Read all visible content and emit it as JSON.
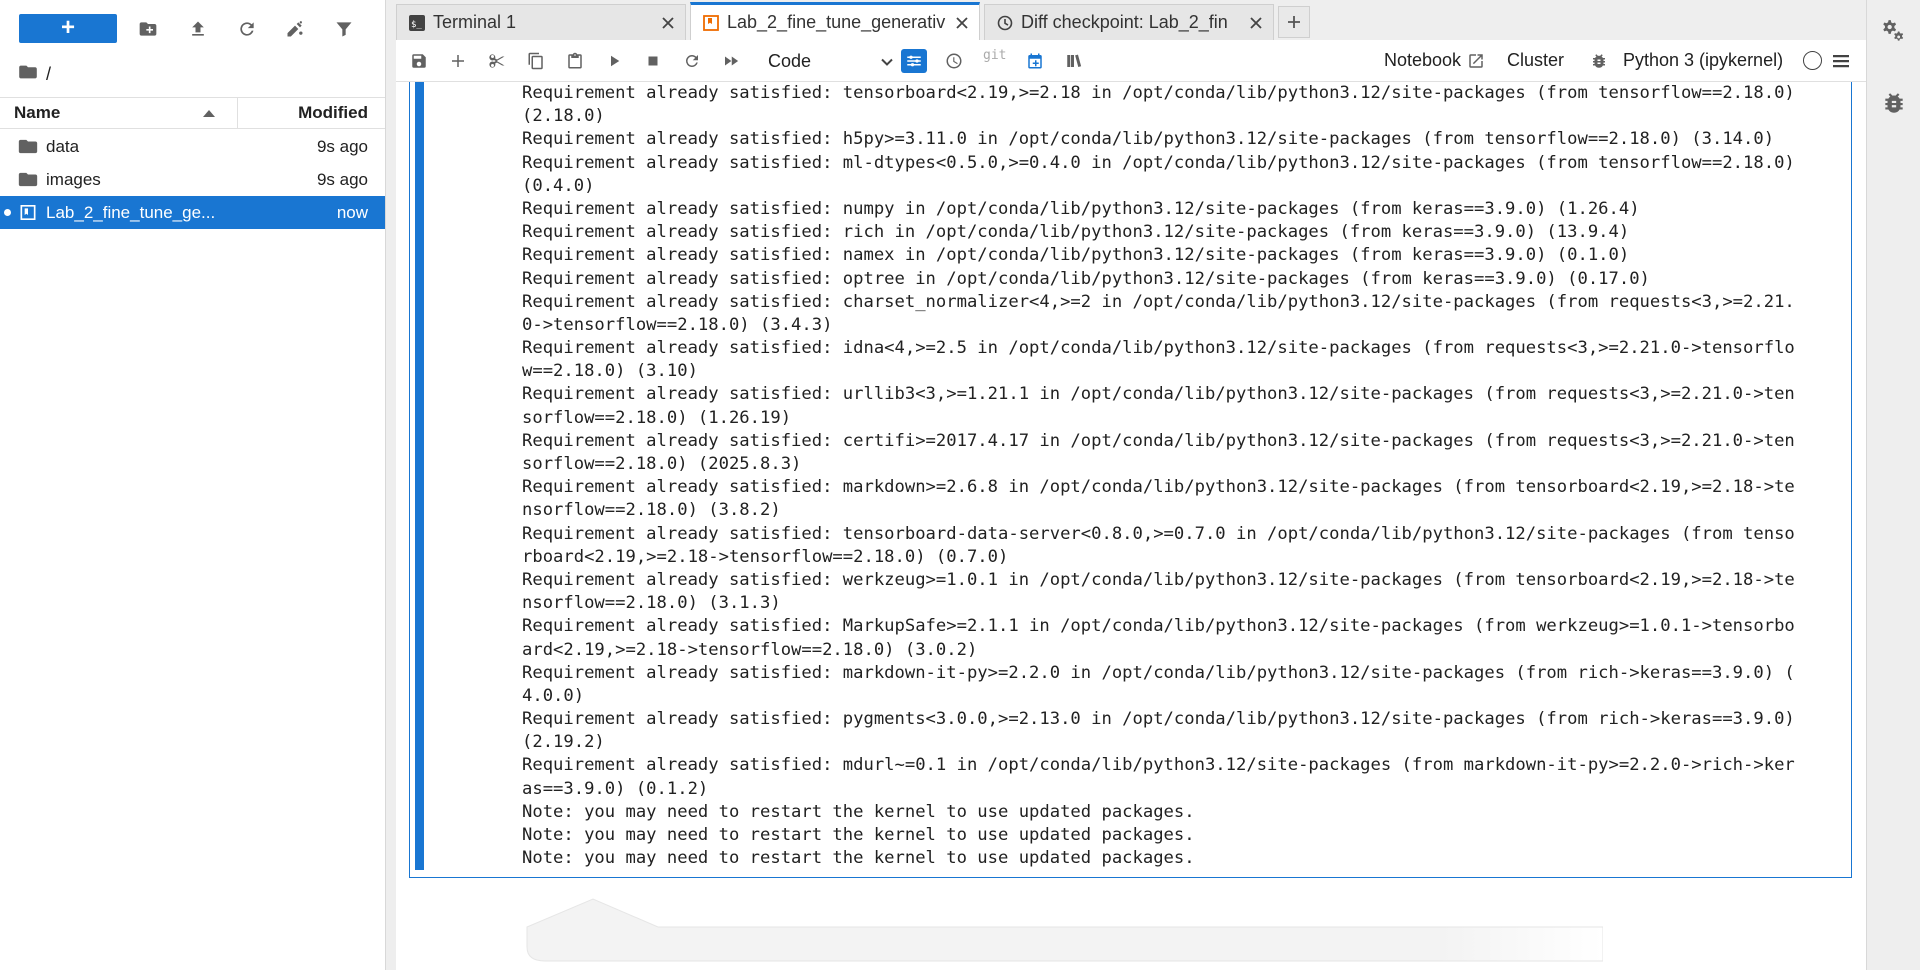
{
  "file_browser": {
    "new_button": "+",
    "path": "/",
    "columns": {
      "name": "Name",
      "modified": "Modified"
    },
    "files": [
      {
        "name": "data",
        "modified": "9s ago",
        "type": "folder"
      },
      {
        "name": "images",
        "modified": "9s ago",
        "type": "folder"
      },
      {
        "name": "Lab_2_fine_tune_ge...",
        "modified": "now",
        "type": "notebook"
      }
    ]
  },
  "tabs": [
    {
      "label": "Terminal 1",
      "icon": "terminal-icon"
    },
    {
      "label": "Lab_2_fine_tune_generativ",
      "icon": "notebook-icon"
    },
    {
      "label": "Diff checkpoint: Lab_2_fin",
      "icon": "clock-icon"
    }
  ],
  "toolbar": {
    "cell_type": "Code",
    "git": "git",
    "notebook": "Notebook",
    "cluster": "Cluster",
    "kernel": "Python 3 (ipykernel)"
  },
  "output_lines": [
    "Requirement already satisfied: tensorboard<2.19,>=2.18 in /opt/conda/lib/python3.12/site-packages (from tensorflow==2.18.0)",
    "(2.18.0)",
    "Requirement already satisfied: h5py>=3.11.0 in /opt/conda/lib/python3.12/site-packages (from tensorflow==2.18.0) (3.14.0)",
    "Requirement already satisfied: ml-dtypes<0.5.0,>=0.4.0 in /opt/conda/lib/python3.12/site-packages (from tensorflow==2.18.0)",
    "(0.4.0)",
    "Requirement already satisfied: numpy in /opt/conda/lib/python3.12/site-packages (from keras==3.9.0) (1.26.4)",
    "Requirement already satisfied: rich in /opt/conda/lib/python3.12/site-packages (from keras==3.9.0) (13.9.4)",
    "Requirement already satisfied: namex in /opt/conda/lib/python3.12/site-packages (from keras==3.9.0) (0.1.0)",
    "Requirement already satisfied: optree in /opt/conda/lib/python3.12/site-packages (from keras==3.9.0) (0.17.0)",
    "Requirement already satisfied: charset_normalizer<4,>=2 in /opt/conda/lib/python3.12/site-packages (from requests<3,>=2.21.",
    "0->tensorflow==2.18.0) (3.4.3)",
    "Requirement already satisfied: idna<4,>=2.5 in /opt/conda/lib/python3.12/site-packages (from requests<3,>=2.21.0->tensorflo",
    "w==2.18.0) (3.10)",
    "Requirement already satisfied: urllib3<3,>=1.21.1 in /opt/conda/lib/python3.12/site-packages (from requests<3,>=2.21.0->ten",
    "sorflow==2.18.0) (1.26.19)",
    "Requirement already satisfied: certifi>=2017.4.17 in /opt/conda/lib/python3.12/site-packages (from requests<3,>=2.21.0->ten",
    "sorflow==2.18.0) (2025.8.3)",
    "Requirement already satisfied: markdown>=2.6.8 in /opt/conda/lib/python3.12/site-packages (from tensorboard<2.19,>=2.18->te",
    "nsorflow==2.18.0) (3.8.2)",
    "Requirement already satisfied: tensorboard-data-server<0.8.0,>=0.7.0 in /opt/conda/lib/python3.12/site-packages (from tenso",
    "rboard<2.19,>=2.18->tensorflow==2.18.0) (0.7.0)",
    "Requirement already satisfied: werkzeug>=1.0.1 in /opt/conda/lib/python3.12/site-packages (from tensorboard<2.19,>=2.18->te",
    "nsorflow==2.18.0) (3.1.3)",
    "Requirement already satisfied: MarkupSafe>=2.1.1 in /opt/conda/lib/python3.12/site-packages (from werkzeug>=1.0.1->tensorbo",
    "ard<2.19,>=2.18->tensorflow==2.18.0) (3.0.2)",
    "Requirement already satisfied: markdown-it-py>=2.2.0 in /opt/conda/lib/python3.12/site-packages (from rich->keras==3.9.0) (",
    "4.0.0)",
    "Requirement already satisfied: pygments<3.0.0,>=2.13.0 in /opt/conda/lib/python3.12/site-packages (from rich->keras==3.9.0)",
    "(2.19.2)",
    "Requirement already satisfied: mdurl~=0.1 in /opt/conda/lib/python3.12/site-packages (from markdown-it-py>=2.2.0->rich->ker",
    "as==3.9.0) (0.1.2)",
    "Note: you may need to restart the kernel to use updated packages.",
    "Note: you may need to restart the kernel to use updated packages.",
    "Note: you may need to restart the kernel to use updated packages."
  ],
  "colors": {
    "accent": "#1976d2",
    "tab_bar": "#eeeeee",
    "icon": "#616161"
  }
}
